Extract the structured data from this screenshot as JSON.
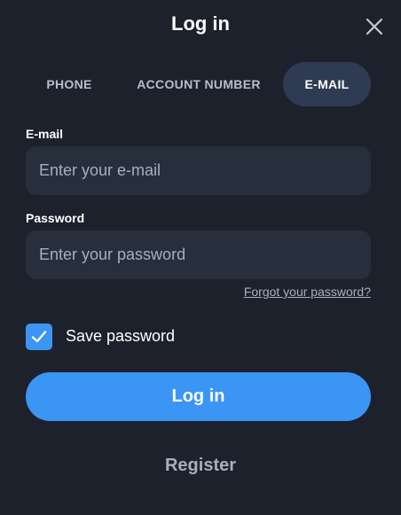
{
  "dialog": {
    "title": "Log in",
    "close_icon": "close-icon"
  },
  "tabs": [
    {
      "label": "PHONE",
      "active": false
    },
    {
      "label": "ACCOUNT NUMBER",
      "active": false
    },
    {
      "label": "E-MAIL",
      "active": true
    }
  ],
  "email": {
    "label": "E-mail",
    "placeholder": "Enter your e-mail",
    "value": ""
  },
  "password": {
    "label": "Password",
    "placeholder": "Enter your password",
    "value": ""
  },
  "forgot_password": "Forgot your password?",
  "save_password": {
    "label": "Save password",
    "checked": true,
    "icon": "checkmark-icon"
  },
  "login_button": "Log in",
  "register_link": "Register",
  "colors": {
    "background": "#1d212c",
    "field": "#272e3c",
    "active_tab": "#2e3b52",
    "accent": "#3a95f5",
    "muted_text": "#a7afbf"
  }
}
